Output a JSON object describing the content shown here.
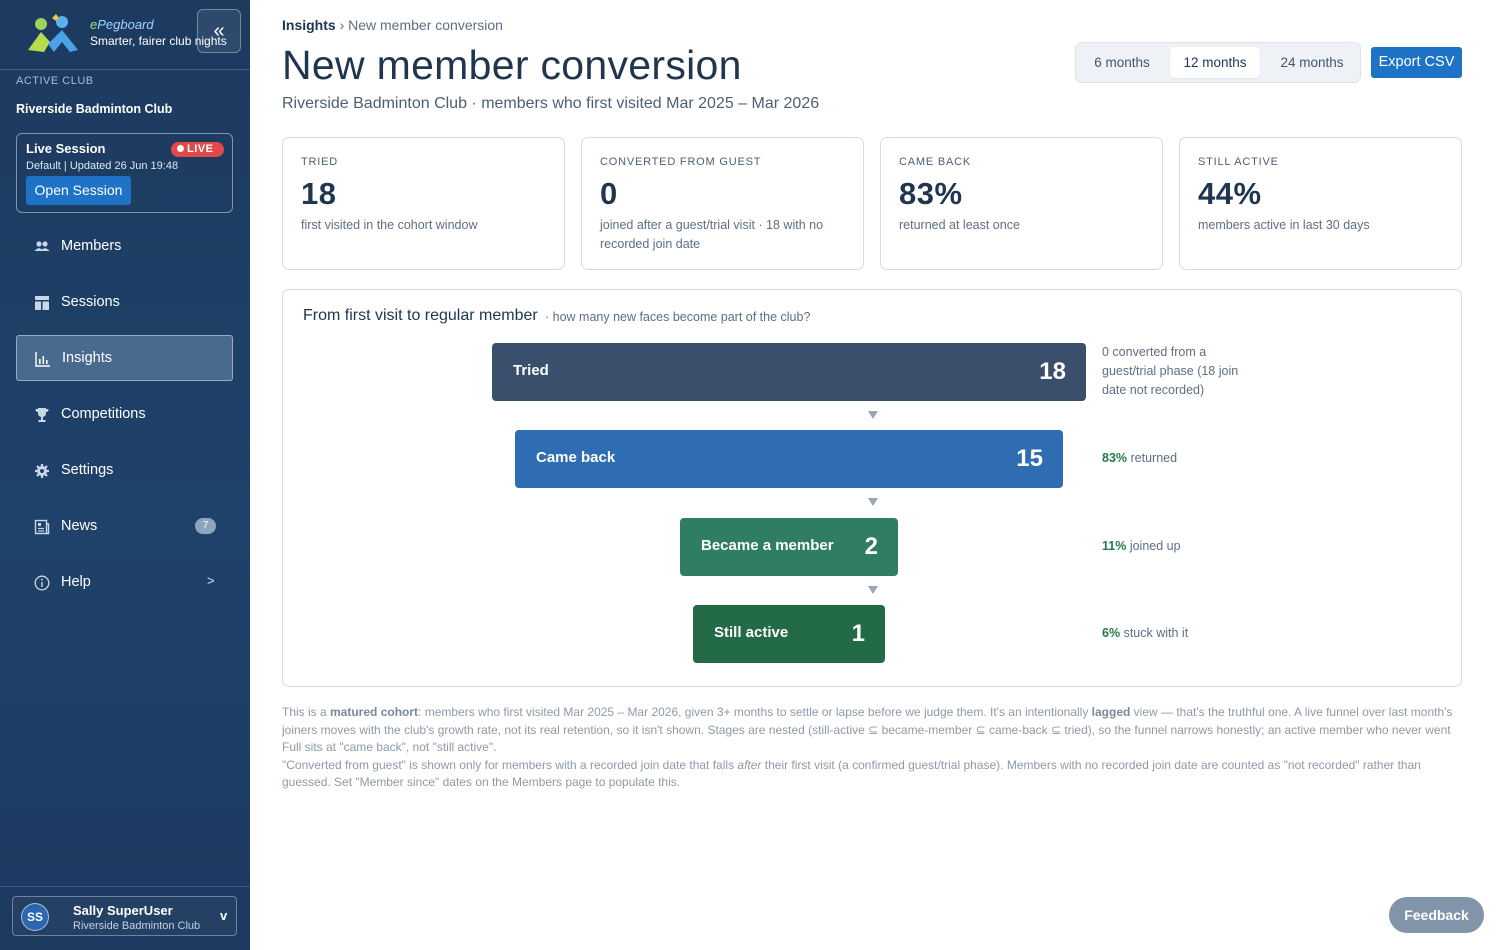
{
  "sidebar": {
    "brand_name_e": "e",
    "brand_name": "Pegboard",
    "brand_tagline": "Smarter, fairer club nights",
    "collapse_icon": "«",
    "active_club_label": "ACTIVE CLUB",
    "active_club_name": "Riverside Badminton Club",
    "live": {
      "title": "Live Session",
      "badge": "LIVE",
      "subtitle": "Default | Updated 26 Jun 19:48",
      "button": "Open Session"
    },
    "nav": [
      {
        "label": "Members",
        "icon": "members-icon"
      },
      {
        "label": "Sessions",
        "icon": "sessions-icon"
      },
      {
        "label": "Insights",
        "icon": "insights-icon",
        "active": true
      },
      {
        "label": "Competitions",
        "icon": "trophy-icon"
      },
      {
        "label": "Settings",
        "icon": "gear-icon"
      },
      {
        "label": "News",
        "icon": "news-icon",
        "badge": "7"
      },
      {
        "label": "Help",
        "icon": "help-icon",
        "chevron": ">"
      }
    ],
    "user": {
      "initials": "SS",
      "name": "Sally SuperUser",
      "club": "Riverside Badminton Club",
      "caret": "v"
    }
  },
  "header": {
    "breadcrumb_root": "Insights",
    "breadcrumb_sep": "›",
    "breadcrumb_current": "New member conversion",
    "title": "New member conversion",
    "subtitle": "Riverside Badminton Club · members who first visited Mar 2025 – Mar 2026",
    "ranges": [
      "6 months",
      "12 months",
      "24 months"
    ],
    "selected_range": "12 months",
    "export_label": "Export CSV"
  },
  "stats": [
    {
      "label": "TRIED",
      "value": "18",
      "desc": "first visited in the cohort window"
    },
    {
      "label": "CONVERTED FROM GUEST",
      "value": "0",
      "desc": "joined after a guest/trial visit · 18 with no recorded join date"
    },
    {
      "label": "CAME BACK",
      "value": "83%",
      "desc": "returned at least once"
    },
    {
      "label": "STILL ACTIVE",
      "value": "44%",
      "desc": "members active in last 30 days"
    }
  ],
  "funnel": {
    "title": "From first visit to regular member",
    "question": "· how many new faces become part of the club?",
    "stages": [
      {
        "label": "Tried",
        "value": "18",
        "note_pct": "",
        "note": "0 converted from a guest/trial phase (18 join date not recorded)",
        "color": "#3a4f6c"
      },
      {
        "label": "Came back",
        "value": "15",
        "note_pct": "83%",
        "note": "returned",
        "color": "#2f6db3"
      },
      {
        "label": "Became a member",
        "value": "2",
        "note_pct": "11%",
        "note": "joined up",
        "color": "#2f7d63"
      },
      {
        "label": "Still active",
        "value": "1",
        "note_pct": "6%",
        "note": "stuck with it",
        "color": "#226b46"
      }
    ]
  },
  "footnote": {
    "p1_a": "This is a ",
    "p1_b": "matured cohort",
    "p1_c": ": members who first visited Mar 2025 – Mar 2026, given 3+ months to settle or lapse before we judge them. It's an intentionally ",
    "p1_d": "lagged",
    "p1_e": " view — that's the truthful one. A live funnel over last month's joiners moves with the club's growth rate, not its real retention, so it isn't shown. Stages are nested (still-active ⊆ became-member ⊆ came-back ⊆ tried), so the funnel narrows honestly; an active member who never went Full sits at \"came back\", not \"still active\".",
    "p2_a": "\"Converted from guest\" is shown only for members with a recorded join date that falls ",
    "p2_b": "after",
    "p2_c": " their first visit (a confirmed guest/trial phase). Members with no recorded join date are counted as \"not recorded\" rather than guessed. Set \"Member since\" dates on the Members page to populate this."
  },
  "feedback_label": "Feedback"
}
